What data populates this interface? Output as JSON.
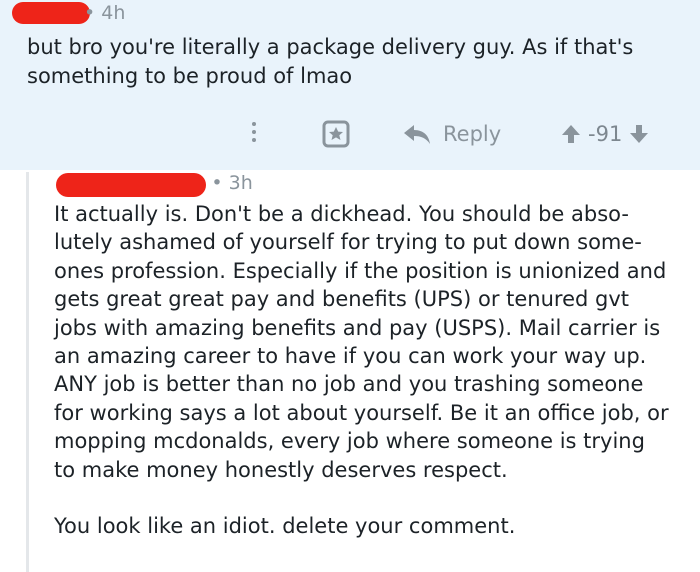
{
  "parent_comment": {
    "time": "4h",
    "body_lines": [
      "but bro you're literally a package delivery guy. As if that's",
      "something to be proud of lmao"
    ],
    "actions": {
      "reply_label": "Reply",
      "score": "-91"
    }
  },
  "reply_comment": {
    "time": "3h",
    "paragraph_1_lines": [
      "It actually is. Don't be a dickhead. You should be abso-",
      "lutely ashamed of yourself for trying to put down some-",
      "ones profession. Especially if the position is unionized and",
      "gets great great pay and benefits (UPS) or tenured gvt",
      "jobs with amazing benefits and pay (USPS). Mail carrier is",
      "an amazing career to have if you can work your way up.",
      "ANY job is better than no job and you trashing someone",
      "for working says a lot about yourself. Be it an office job, or",
      "mopping mcdonalds, every job where someone is trying",
      "to make money honestly deserves respect."
    ],
    "paragraph_2": "You look like an idiot. delete your comment."
  },
  "colors": {
    "highlight_bg": "#e9f3fb",
    "redaction": "#ee2419",
    "meta_gray": "#8a949c",
    "text": "#1c2227"
  },
  "icons": [
    "more-vertical-icon",
    "award-icon",
    "reply-arrow-icon",
    "upvote-icon",
    "downvote-icon"
  ]
}
